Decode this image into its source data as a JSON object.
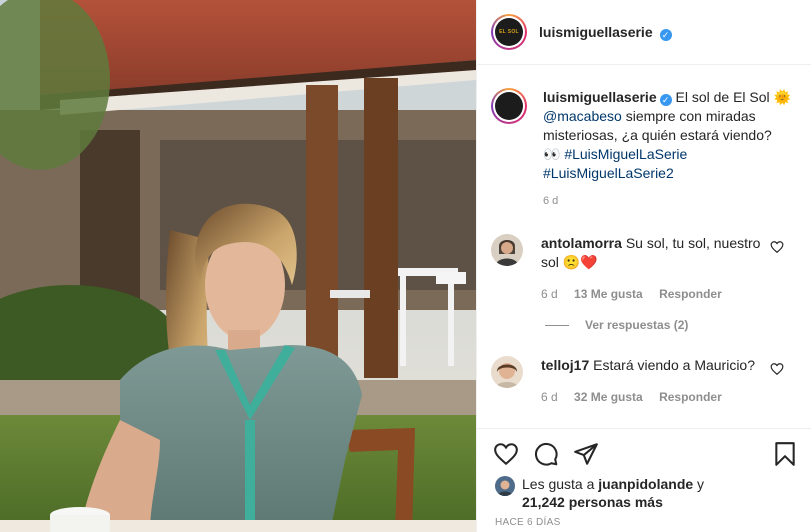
{
  "post": {
    "username": "luismiguellaserie",
    "avatar_text": "EL SOL",
    "caption": {
      "username": "luismiguellaserie",
      "text_1": "El sol de El Sol",
      "emoji_sun": "🌞",
      "mention": "@macabeso",
      "text_2": " siempre con miradas misteriosas, ¿a quién estará viendo?",
      "emoji_eyes": "👀",
      "hashtag_1": "#LuisMiguelLaSerie",
      "hashtag_2": "#LuisMiguelLaSerie2",
      "time": "6 d"
    },
    "comments": [
      {
        "username": "antolamorra",
        "text": "Su sol, tu sol, nuestro sol",
        "emoji": "🙁❤️",
        "time": "6 d",
        "likes": "13 Me gusta",
        "reply_label": "Responder",
        "view_replies": "Ver respuestas (2)"
      },
      {
        "username": "telloj17",
        "text": "Estará viendo a Mauricio?",
        "time": "6 d",
        "likes": "32 Me gusta",
        "reply_label": "Responder"
      }
    ],
    "likes": {
      "prefix": "Les gusta a ",
      "user": "juanpidolande",
      "connector": " y",
      "others": "21,242 personas más"
    },
    "date": "HACE 6 DÍAS"
  },
  "icons": {
    "like": "heart-icon",
    "comment": "comment-icon",
    "share": "share-icon",
    "save": "bookmark-icon",
    "verified": "verified-badge-icon"
  },
  "colors": {
    "verified": "#3897f0",
    "link": "#00376b",
    "muted": "#8e8e8e",
    "heart_emoji": "#e0245e"
  }
}
